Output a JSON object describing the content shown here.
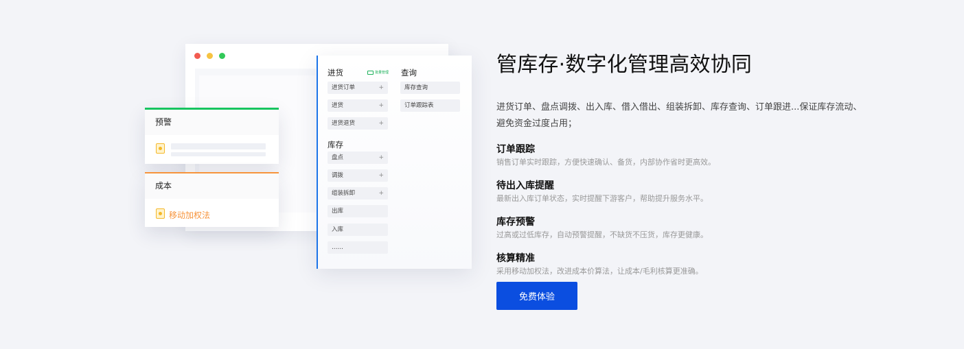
{
  "headline": "管库存·数字化管理高效协同",
  "intro": "进货订单、盘点调拨、出入库、借入借出、组装拆卸、库存查询、订单跟进...保证库存流动、避免资金过度占用；",
  "features": [
    {
      "title": "订单跟踪",
      "desc": "销售订单实时跟踪，方便快速确认、备货，内部协作省时更高效。"
    },
    {
      "title": "待出入库提醒",
      "desc": "最新出入库订单状态，实时提醒下游客户，帮助提升服务水平。"
    },
    {
      "title": "库存预警",
      "desc": "过高或过低库存，自动预警提醒，不缺货不压货，库存更健康。"
    },
    {
      "title": "核算精准",
      "desc": "采用移动加权法，改进成本价算法，让成本/毛利核算更准确。"
    }
  ],
  "cta_label": "免费体验",
  "menu": {
    "purchase": {
      "title": "进货",
      "badge": "批量管理",
      "items": [
        "进货订单",
        "进货",
        "进货退货"
      ]
    },
    "inventory": {
      "title": "库存",
      "items": [
        "盘点",
        "调拨",
        "组装拆卸",
        "出库",
        "入库",
        "……"
      ]
    },
    "query": {
      "title": "查询",
      "items": [
        "库存查询",
        "订单跟踪表"
      ]
    },
    "plus_glyph": "+"
  },
  "warning_card": {
    "title": "预警"
  },
  "cost_card": {
    "title": "成本",
    "method": "移动加权法"
  },
  "colors": {
    "accent_blue": "#0b4ee0",
    "menu_border": "#1a73e8",
    "warning_green": "#17c45f",
    "cost_orange": "#f7933a",
    "icon_yellow": "#f5b829",
    "dot_red": "#f25b50",
    "dot_yellow": "#f6c342",
    "dot_green": "#32c959"
  }
}
